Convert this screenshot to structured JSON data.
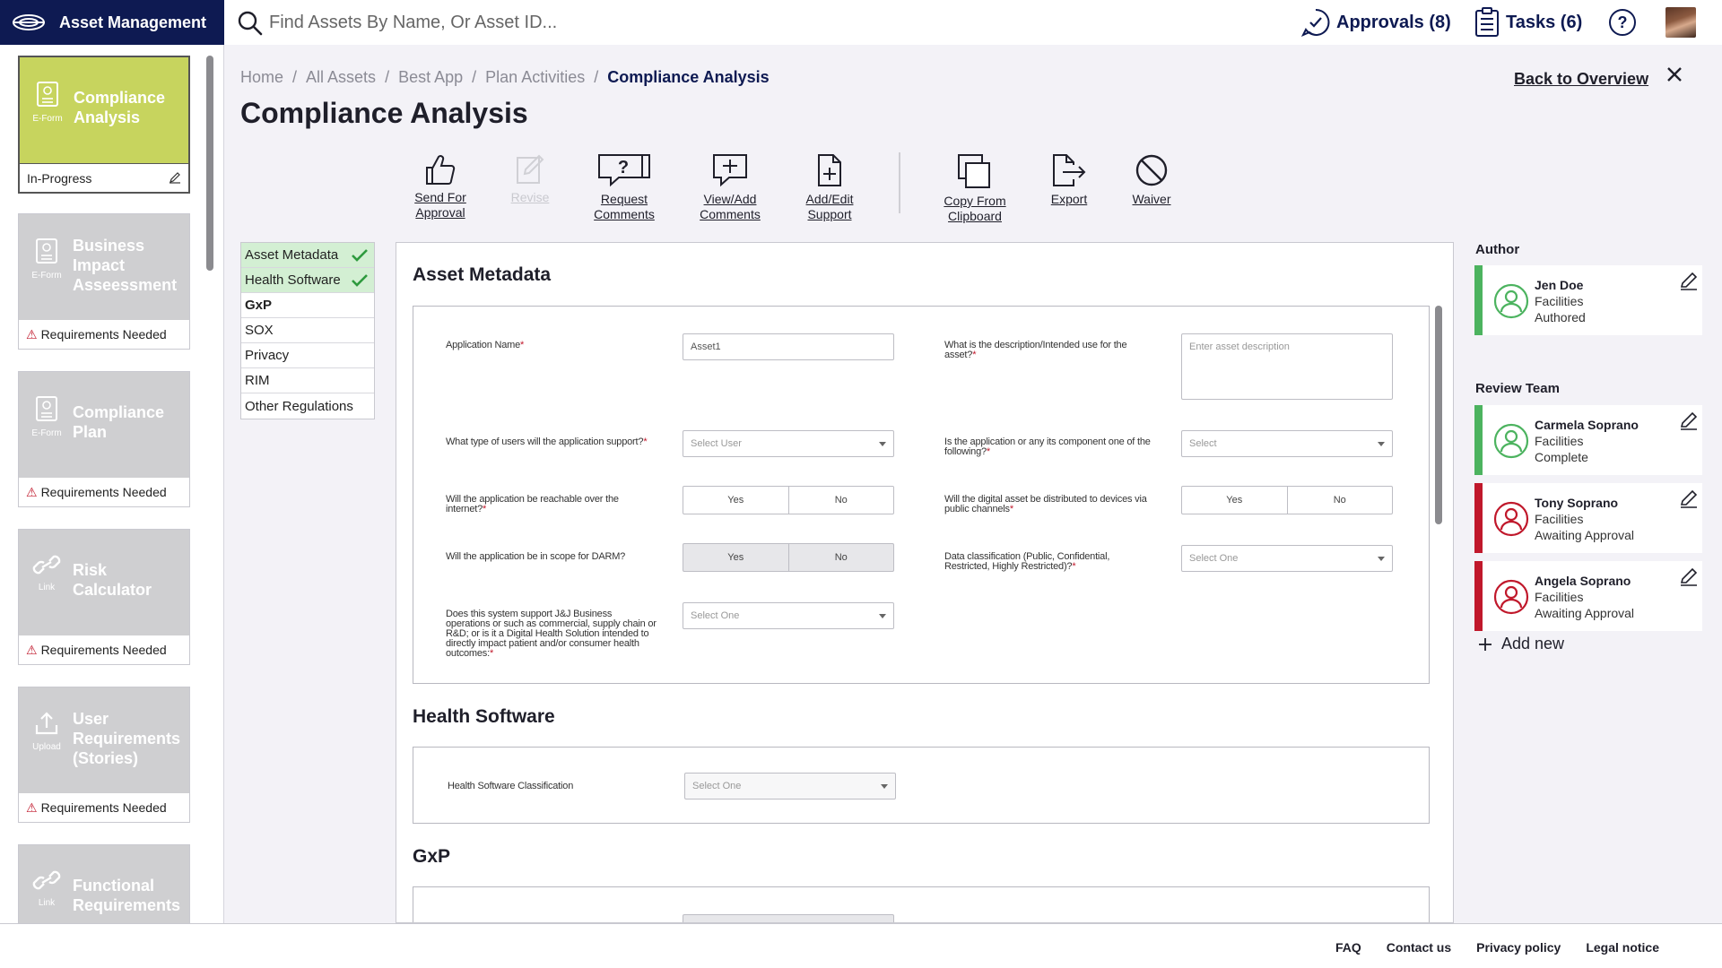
{
  "header": {
    "app_title": "Asset Management",
    "search_placeholder": "Find Assets By Name, Or Asset ID...",
    "approvals_label": "Approvals (8)",
    "tasks_label": "Tasks (6)"
  },
  "rail": {
    "cards": [
      {
        "title": "Compliance Analysis",
        "type": "E-Form",
        "status": "In-Progress"
      },
      {
        "title": "Business Impact Asseessment",
        "type": "E-Form",
        "status": "Requirements Needed"
      },
      {
        "title": "Compliance Plan",
        "type": "E-Form",
        "status": "Requirements Needed"
      },
      {
        "title": "Risk Calculator",
        "type": "Link",
        "status": "Requirements Needed"
      },
      {
        "title": "User Requirements (Stories)",
        "type": "Upload",
        "status": "Requirements Needed"
      },
      {
        "title": "Functional Requirements",
        "type": "Link",
        "status": ""
      }
    ]
  },
  "breadcrumb": {
    "items": [
      "Home",
      "All Assets",
      "Best App",
      "Plan Activities"
    ],
    "current": "Compliance Analysis",
    "separator": "/"
  },
  "page": {
    "title": "Compliance Analysis",
    "back_label": "Back to Overview"
  },
  "toolbar": {
    "send_for_approval": "Send For Approval",
    "revise": "Revise",
    "request_comments": "Request Comments",
    "view_add_comments": "View/Add Comments",
    "add_edit_support": "Add/Edit Support",
    "copy_from_clipboard": "Copy From Clipboard",
    "export": "Export",
    "waiver": "Waiver"
  },
  "section_nav": {
    "items": [
      {
        "label": "Asset Metadata",
        "done": true
      },
      {
        "label": "Health Software",
        "done": true
      },
      {
        "label": "GxP",
        "done": false,
        "current": true
      },
      {
        "label": "SOX",
        "done": false
      },
      {
        "label": "Privacy",
        "done": false
      },
      {
        "label": "RIM",
        "done": false
      },
      {
        "label": "Other Regulations",
        "done": false
      }
    ]
  },
  "form": {
    "asset_metadata": {
      "heading": "Asset Metadata",
      "app_name_q": "Application Name",
      "app_name_value": "Asset1",
      "description_q": "What is the description/Intended use for the asset?",
      "description_placeholder": "Enter asset description",
      "users_q": "What type of users will the application support?",
      "users_placeholder": "Select User",
      "component_q": "Is the application or any its component one of the following?",
      "component_placeholder": "Select",
      "internet_q": "Will the application be reachable over the internet?",
      "public_channels_q": "Will the digital asset be distributed to devices via public channels",
      "darm_q": "Will the application be in scope for DARM?",
      "data_class_q": "Data classification (Public, Confidential, Restricted, Highly Restricted)?",
      "data_class_placeholder": "Select One",
      "business_ops_q": "Does this system support J&J Business operations or such as commercial, supply chain or R&D; or is it a Digital Health Solution intended to directly impact patient and/or consumer health outcomes:",
      "business_ops_placeholder": "Select One",
      "yes": "Yes",
      "no": "No"
    },
    "health_software": {
      "heading": "Health Software",
      "classification_q": "Health Software Classification",
      "classification_placeholder": "Select One"
    },
    "gxp": {
      "heading": "GxP"
    }
  },
  "right_panel": {
    "author_label": "Author",
    "author": {
      "name": "Jen Doe",
      "dept": "Facilities",
      "status": "Authored"
    },
    "review_label": "Review Team",
    "reviewers": [
      {
        "name": "Carmela Soprano",
        "dept": "Facilities",
        "status": "Complete"
      },
      {
        "name": "Tony Soprano",
        "dept": "Facilities",
        "status": "Awaiting Approval"
      },
      {
        "name": "Angela Soprano",
        "dept": "Facilities",
        "status": "Awaiting Approval"
      }
    ],
    "add_new_label": "Add new"
  },
  "footer": {
    "faq": "FAQ",
    "contact": "Contact us",
    "privacy": "Privacy policy",
    "legal": "Legal notice"
  },
  "colors": {
    "brand_navy": "#0e1a52",
    "active_card": "#c7d45e",
    "complete_green": "#4cb35f",
    "pending_red": "#c0182b"
  }
}
